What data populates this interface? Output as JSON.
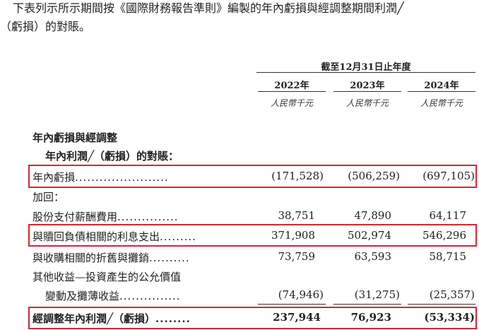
{
  "intro": {
    "line1": "下表列示所示期間按《國際財務報告準則》編製的年內虧損與經調整期間利潤╱",
    "line2": "（虧損）的對賬。"
  },
  "header": {
    "period": "截至12月31日止年度",
    "years": [
      "2022年",
      "2023年",
      "2024年"
    ],
    "unit": "人民幣千元"
  },
  "section_title": "年內虧損與經調整",
  "section_subtitle": "年內利潤╱（虧損）的對賬：",
  "rows": [
    {
      "label": "年內虧損",
      "dots": ".......................",
      "values": [
        "(171,528)",
        "(506,259)",
        "(697,105)"
      ]
    },
    {
      "label": "加回：",
      "dots": "",
      "values": [
        "",
        "",
        ""
      ]
    },
    {
      "label": "股份支付薪酬費用",
      "dots": "...............",
      "values": [
        "38,751",
        "47,890",
        "64,117"
      ]
    },
    {
      "label": "與贖回負債相關的利息支出",
      "dots": ".........",
      "values": [
        "371,908",
        "502,974",
        "546,296"
      ]
    },
    {
      "label": "與收購相關的折舊與攤銷",
      "dots": "..........",
      "values": [
        "73,759",
        "63,593",
        "58,715"
      ]
    },
    {
      "label": "其他收益—投資產生的公允價值",
      "dots": "",
      "values": [
        "",
        "",
        ""
      ]
    },
    {
      "label": "變動及攤薄收益",
      "dots": "...............",
      "values": [
        "(74,946)",
        "(31,275)",
        "(25,357)"
      ]
    },
    {
      "label": "經調整年內利潤╱（虧損）",
      "dots": "........",
      "values": [
        "237,944",
        "76,923",
        "(53,334)"
      ]
    }
  ]
}
